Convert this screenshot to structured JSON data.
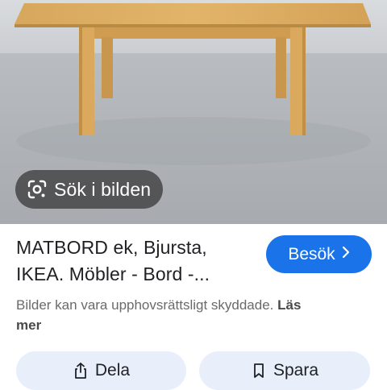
{
  "image": {
    "lens_label": "Sök i bilden"
  },
  "result": {
    "title_line1": "MATBORD ek, Bjursta,",
    "title_line2": "IKEA. Möbler - Bord -...",
    "visit_label": "Besök",
    "disclaimer_text": "Bilder kan vara upphovsrättsligt skyddade.",
    "read_more_label_1": "Läs",
    "read_more_label_2": "mer"
  },
  "actions": {
    "share_label": "Dela",
    "save_label": "Spara"
  },
  "icons": {
    "lens": "google-lens-icon",
    "visit": "chevron-right-icon",
    "share": "share-icon",
    "save": "bookmark-icon"
  },
  "colors": {
    "accent": "#1a73e8",
    "chip_background": "#3c3c3c",
    "action_button_background": "#e8effb"
  }
}
